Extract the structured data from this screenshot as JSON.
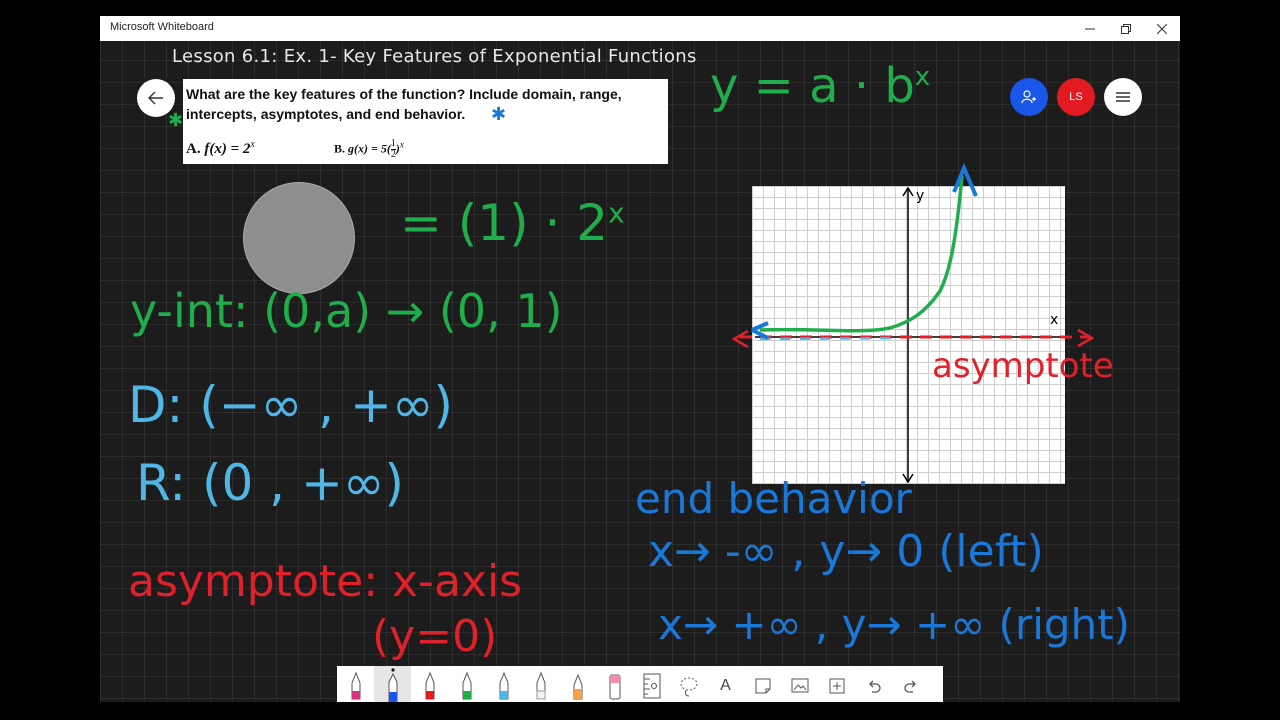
{
  "window": {
    "title": "Microsoft Whiteboard",
    "controls": [
      "minimize-icon",
      "restore-icon",
      "close-icon"
    ]
  },
  "lesson_title": "Lesson 6.1: Ex. 1- Key Features of Exponential Functions",
  "question": {
    "text": "What are the key features of the function? Include domain, range, intercepts, asymptotes, and end behavior.",
    "option_a_letter": "A.",
    "option_a_fn": "f(x) = 2",
    "option_a_exp": "x",
    "option_b_letter": "B.",
    "option_b_fn": "g(x) = 5(",
    "option_b_frac_num": "1",
    "option_b_frac_den": "2",
    "option_b_close": ")",
    "option_b_exp": "x"
  },
  "header_right": {
    "invite_icon": "add-person-icon",
    "user_initials": "LS",
    "menu_icon": "hamburger-icon",
    "colors": {
      "invite": "#1a56e8",
      "user": "#e21b23",
      "menu": "#ffffff"
    }
  },
  "ink": {
    "general_form": "y = a · b",
    "general_form_exp": "x",
    "substituted": "= (1) · 2",
    "substituted_exp": "x",
    "y_intercept": "y-int: (0,a) → (0, 1)",
    "domain": "D: (−∞ , +∞)",
    "range": "R: (0 , +∞)",
    "asymptote": "asymptote: x-axis",
    "asymptote_eq": "(y=0)",
    "graph_asymptote_label": "asymptote",
    "graph_x_label": "x",
    "graph_y_label": "y",
    "end_behavior_title": "end behavior",
    "end_left": "x→ -∞ , y→ 0  (left)",
    "end_right": "x→ +∞ , y→ +∞ (right)",
    "colors": {
      "green": "#1fae4b",
      "blue": "#1a78d8",
      "red": "#e0202a",
      "lightblue": "#4fb6e6"
    }
  },
  "toolbar": {
    "tools": [
      "pen-pink-icon",
      "pen-blue-icon",
      "pen-red-icon",
      "pen-green-icon",
      "pen-lightblue-icon",
      "pen-white-icon",
      "highlighter-icon",
      "eraser-icon",
      "ruler-icon",
      "lasso-icon",
      "text-icon",
      "sticky-note-icon",
      "image-icon",
      "add-icon",
      "undo-icon",
      "redo-icon"
    ],
    "selected_tool": "pen-blue-icon",
    "text_tool_label": "A"
  }
}
